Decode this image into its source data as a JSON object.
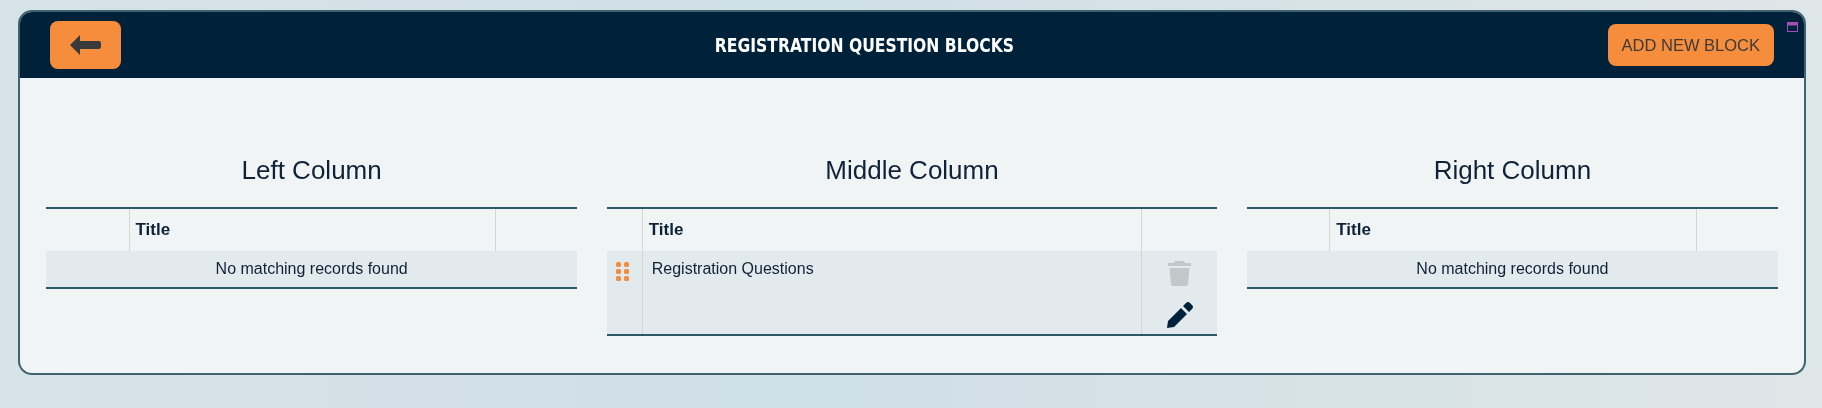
{
  "header": {
    "title": "REGISTRATION QUESTION BLOCKS",
    "add_button": "ADD NEW BLOCK"
  },
  "columns": [
    {
      "title": "Left Column",
      "kind": "empty",
      "table": {
        "columns": [
          "Title"
        ],
        "empty_message": "No matching records found"
      }
    },
    {
      "title": "Middle Column",
      "kind": "rows",
      "table": {
        "columns": [
          "Title"
        ],
        "rows": [
          {
            "title": "Registration Questions",
            "delete_disabled": true
          }
        ]
      }
    },
    {
      "title": "Right Column",
      "kind": "empty",
      "table": {
        "columns": [
          "Title"
        ],
        "empty_message": "No matching records found"
      }
    }
  ]
}
